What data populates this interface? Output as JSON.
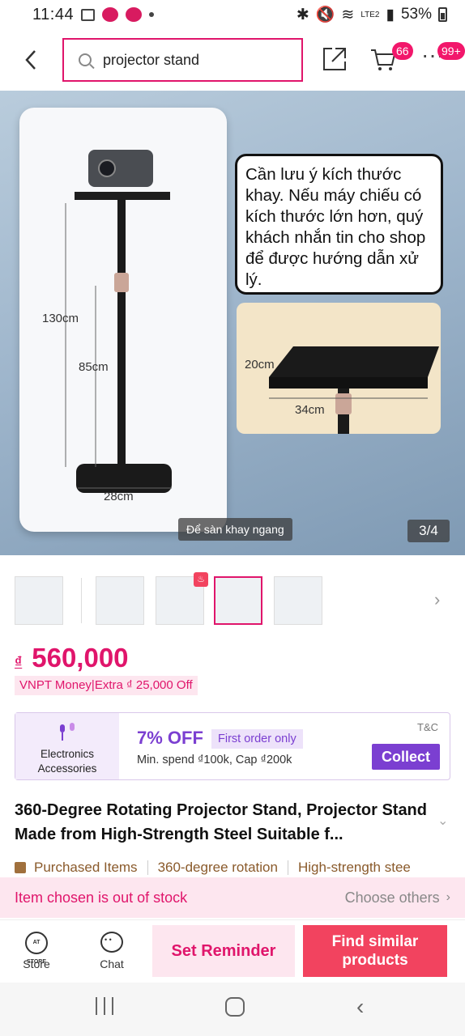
{
  "status_bar": {
    "time": "11:44",
    "network": "LTE2",
    "battery": "53%"
  },
  "header": {
    "search_query": "projector stand",
    "cart_badge": "66",
    "more_badge": "99+"
  },
  "gallery": {
    "dim_height_total": "130cm",
    "dim_height_min": "85cm",
    "dim_base_width": "28cm",
    "note_text": "Cần lưu ý kích thước khay. Nếu máy chiếu có kích thước lớn hơn, quý khách nhắn tin cho shop để được hướng dẫn xử lý.",
    "dim_tray_depth": "20cm",
    "dim_tray_width": "34cm",
    "caption": "Để sàn khay ngang",
    "counter": "3/4"
  },
  "price": {
    "currency": "₫",
    "amount": "560,000",
    "promo": "VNPT Money|Extra ₫ 25,000 Off"
  },
  "voucher": {
    "category": "Electronics Accessories",
    "discount": "7% OFF",
    "tag": "First order only",
    "terms": "Min. spend ₫100k, Cap ₫200k",
    "tc": "T&C",
    "collect": "Collect"
  },
  "product": {
    "title": "360-Degree Rotating Projector Stand, Projector Stand Made from High-Strength Steel Suitable f..."
  },
  "tags": [
    "Purchased Items",
    "360-degree rotation",
    "High-strength stee"
  ],
  "stock": {
    "message": "Item chosen is out of stock",
    "alternative": "Choose others"
  },
  "actions": {
    "store_icon_text": "AT STORE",
    "store": "Store",
    "chat": "Chat",
    "reminder": "Set Reminder",
    "similar": "Find similar products"
  }
}
